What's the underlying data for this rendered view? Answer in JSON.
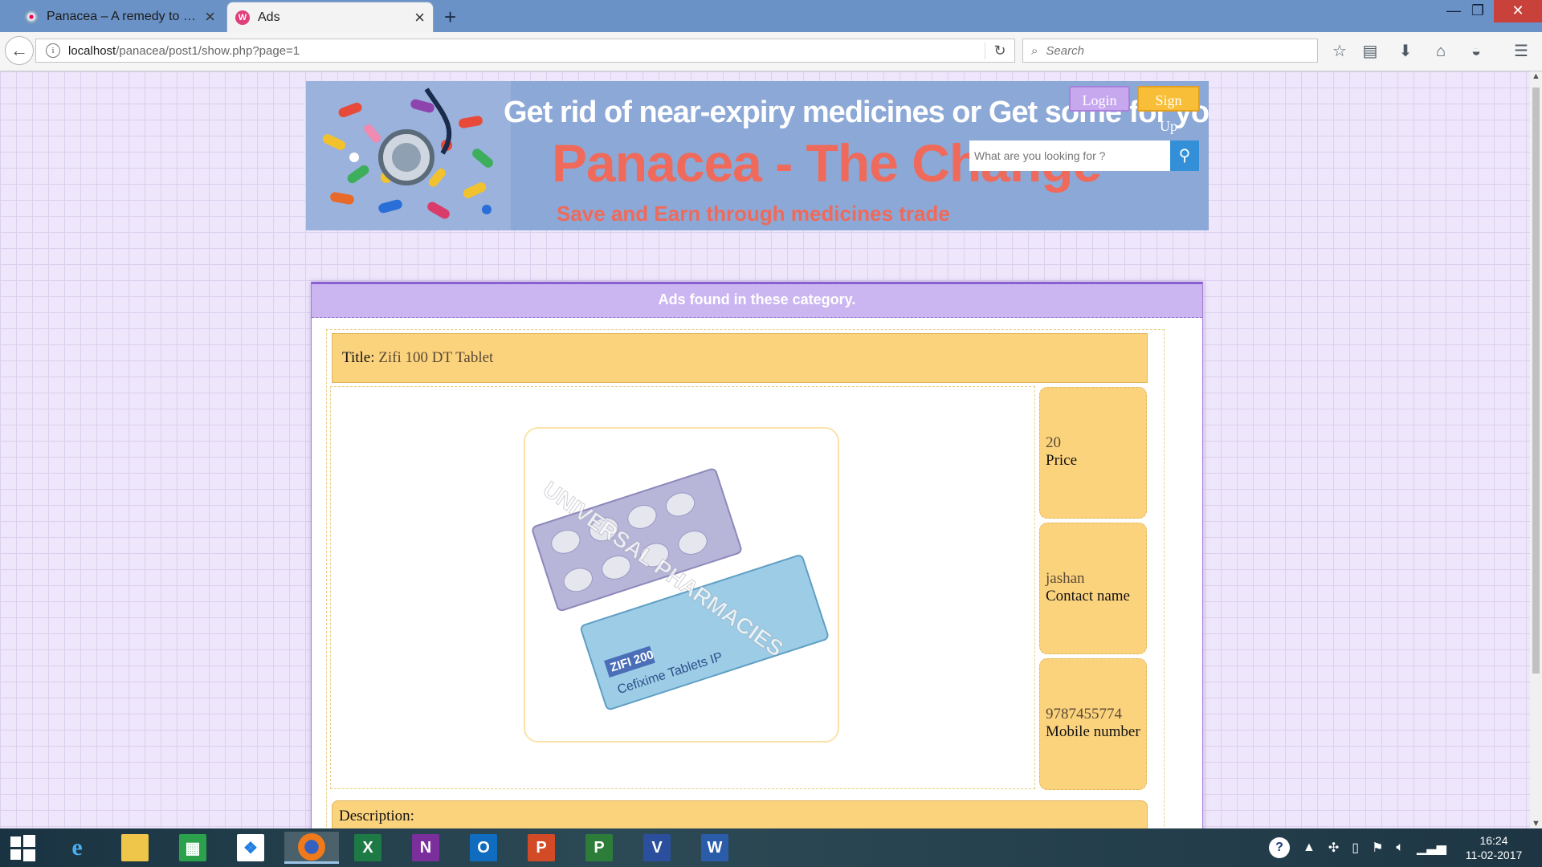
{
  "browser": {
    "tabs": [
      {
        "label": "Panacea – A remedy to all...",
        "active": false
      },
      {
        "label": "Ads",
        "active": true
      }
    ],
    "new_tab_symbol": "+",
    "url_host": "localhost",
    "url_path": "/panacea/post1/show.php?page=1",
    "search_placeholder": "Search"
  },
  "header": {
    "tagline": "Get rid of near-expiry medicines or Get some for you",
    "site_title": "Panacea - The Change",
    "subtitle": "Save and Earn through medicines trade",
    "login_label": "Login",
    "signup_label": "Sign Up",
    "search_placeholder": "What are you looking for ?"
  },
  "results": {
    "heading": "Ads found in these category.",
    "ad": {
      "title_label": "Title:",
      "title_value": "Zifi 100 DT Tablet",
      "image_watermark": "UNIVERSAL PHARMACIES",
      "image_pack_text_1": "ZIFI 200",
      "image_pack_text_2": "Cefixime Tablets IP",
      "price_value": "20",
      "price_label": "Price",
      "contact_value": "jashan",
      "contact_label": "Contact name",
      "mobile_value": "9787455774",
      "mobile_label": "Mobile number",
      "description_label": "Description:"
    }
  },
  "taskbar": {
    "apps": [
      "windows-start",
      "internet-explorer",
      "file-explorer",
      "store",
      "dropbox",
      "firefox",
      "excel",
      "onenote",
      "outlook",
      "powerpoint",
      "project",
      "visio",
      "word"
    ],
    "time": "16:24",
    "date": "11-02-2017"
  },
  "colors": {
    "titlebar": "#6b92c6",
    "page_bg": "#eee6fa",
    "banner_bg": "#8ca8d6",
    "panel_header": "#cbb6f2",
    "card_yellow": "#fcd37d",
    "title_red": "#ef6a5a",
    "close_red": "#c8413a"
  }
}
